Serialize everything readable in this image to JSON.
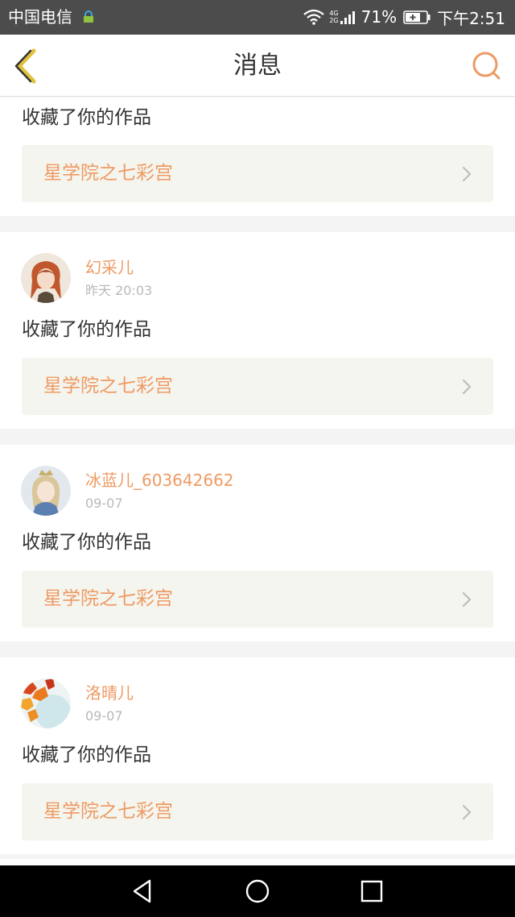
{
  "status_bar": {
    "carrier": "中国电信",
    "network": [
      "4G",
      "2G"
    ],
    "battery_percent": "71%",
    "time": "下午2:51"
  },
  "header": {
    "title": "消息",
    "back_icon": "chevron-left-icon",
    "search_icon": "search-icon"
  },
  "messages": [
    {
      "user": "",
      "time": "",
      "action": "收藏了你的作品",
      "work": "星学院之七彩宫"
    },
    {
      "user": "幻采儿",
      "time": "昨天 20:03",
      "action": "收藏了你的作品",
      "work": "星学院之七彩宫"
    },
    {
      "user": "冰蓝儿_603642662",
      "time": "09-07",
      "action": "收藏了你的作品",
      "work": "星学院之七彩宫"
    },
    {
      "user": "洛晴儿",
      "time": "09-07",
      "action": "收藏了你的作品",
      "work": "星学院之七彩宫"
    }
  ],
  "nav_bar": [
    "back-triangle-icon",
    "home-circle-icon",
    "recents-square-icon"
  ],
  "colors": {
    "accent": "#ee9a63",
    "status_bar": "#4c4c4c",
    "card_bg": "#ffffff",
    "link_bg": "#f5f5ef",
    "page_bg": "#f4f4f4"
  }
}
